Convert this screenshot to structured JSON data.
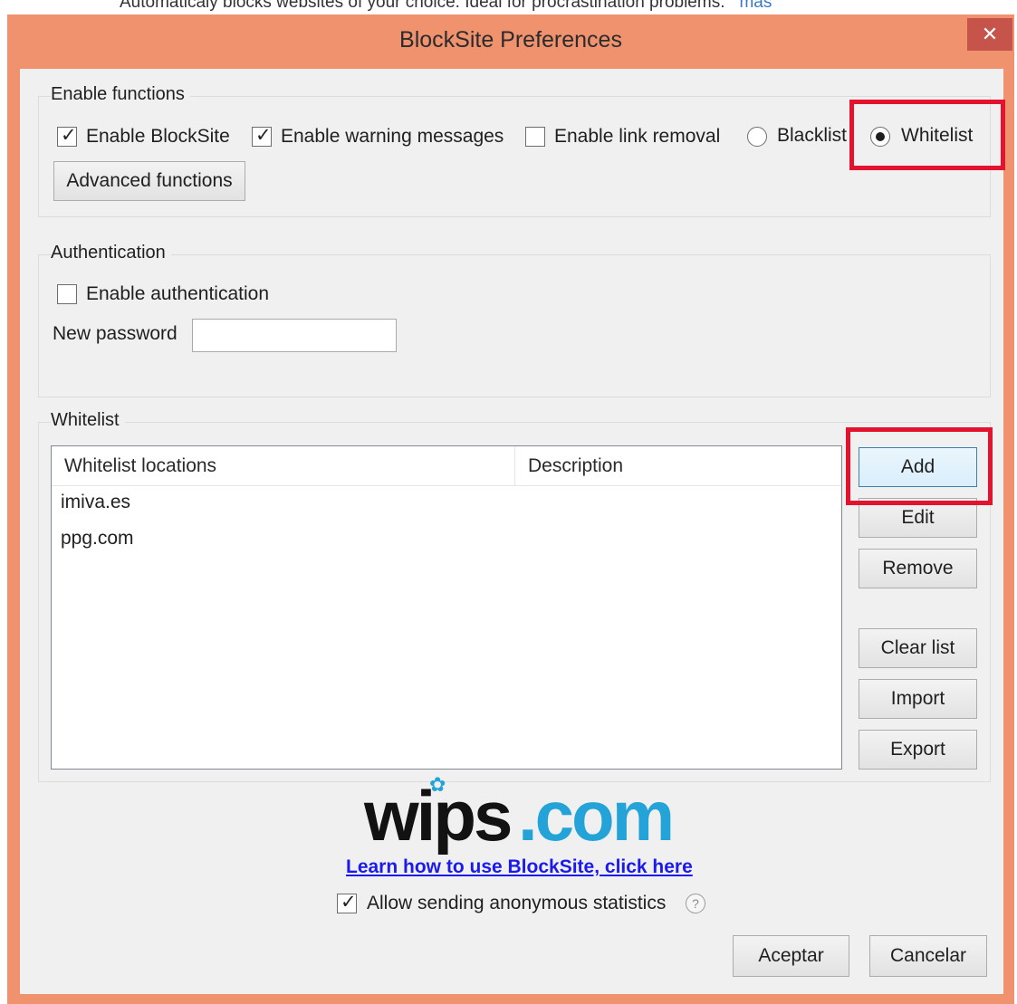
{
  "background_text": {
    "line": "Automaticaly blocks websites of your choice. Ideal for procrastination problems.",
    "link": "más"
  },
  "window": {
    "title": "BlockSite Preferences",
    "close_glyph": "✕"
  },
  "enable_functions": {
    "label": "Enable functions",
    "enable_blocksite": {
      "label": "Enable BlockSite",
      "checked": true
    },
    "enable_warning": {
      "label": "Enable warning messages",
      "checked": true
    },
    "enable_link_removal": {
      "label": "Enable link removal",
      "checked": false
    },
    "blacklist": {
      "label": "Blacklist",
      "selected": false
    },
    "whitelist": {
      "label": "Whitelist",
      "selected": true
    },
    "advanced_button": "Advanced functions"
  },
  "authentication": {
    "label": "Authentication",
    "enable_auth": {
      "label": "Enable authentication",
      "checked": false
    },
    "password_label": "New password",
    "password_value": ""
  },
  "whitelist": {
    "label": "Whitelist",
    "columns": [
      "Whitelist locations",
      "Description"
    ],
    "rows": [
      {
        "location": "imiva.es",
        "description": ""
      },
      {
        "location": "ppg.com",
        "description": ""
      }
    ],
    "buttons": {
      "add": "Add",
      "edit": "Edit",
      "remove": "Remove",
      "clear": "Clear list",
      "import": "Import",
      "export": "Export"
    }
  },
  "footer": {
    "logo_left": "wips",
    "logo_right": ".com",
    "learn_link": "Learn how to use BlockSite, click here",
    "stats": {
      "label": "Allow sending anonymous statistics",
      "checked": true
    },
    "help_glyph": "?",
    "ok_button": "Aceptar",
    "cancel_button": "Cancelar"
  },
  "colors": {
    "titlebar": "#f0926e",
    "close_button": "#c7544a",
    "highlight": "#e3122f",
    "logo_blue": "#23a3d8"
  },
  "icons": {
    "check": "✓",
    "gear": "✿"
  }
}
